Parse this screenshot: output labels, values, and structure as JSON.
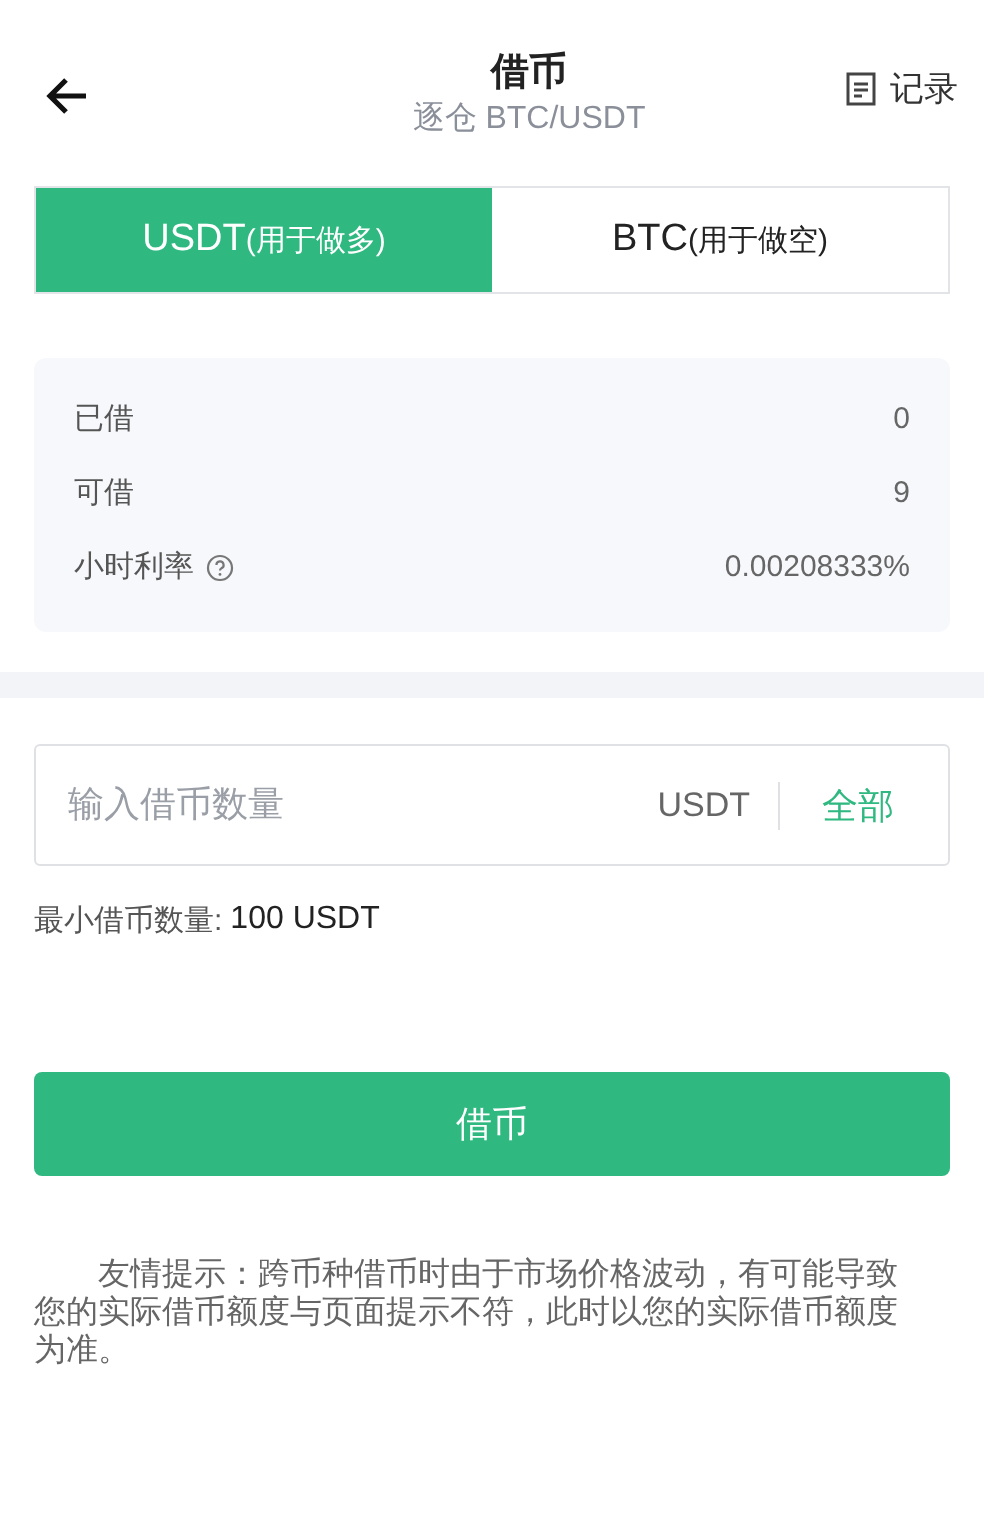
{
  "header": {
    "title": "借币",
    "subtitle": "逐仓 BTC/USDT",
    "record_link": "记录"
  },
  "tabs": [
    {
      "label": "USDT",
      "note": "(用于做多)",
      "selected": true
    },
    {
      "label": "BTC",
      "note": "(用于做空)",
      "selected": false
    }
  ],
  "stats": [
    {
      "label": "已借",
      "value": "0",
      "help": false
    },
    {
      "label": "可借",
      "value": "9",
      "help": false
    },
    {
      "label": "小时利率",
      "value": "0.00208333%",
      "help": true
    }
  ],
  "amount_field": {
    "placeholder": "输入借币数量",
    "unit": "USDT",
    "all_button": "全部"
  },
  "minimum": {
    "label": "最小借币数量:",
    "value": "100 USDT"
  },
  "submit_button": "借币",
  "notice": "友情提示：跨币种借币时由于市场价格波动，有可能导致您的实际借币额度与页面提示不符，此时以您的实际借币额度为准。"
}
